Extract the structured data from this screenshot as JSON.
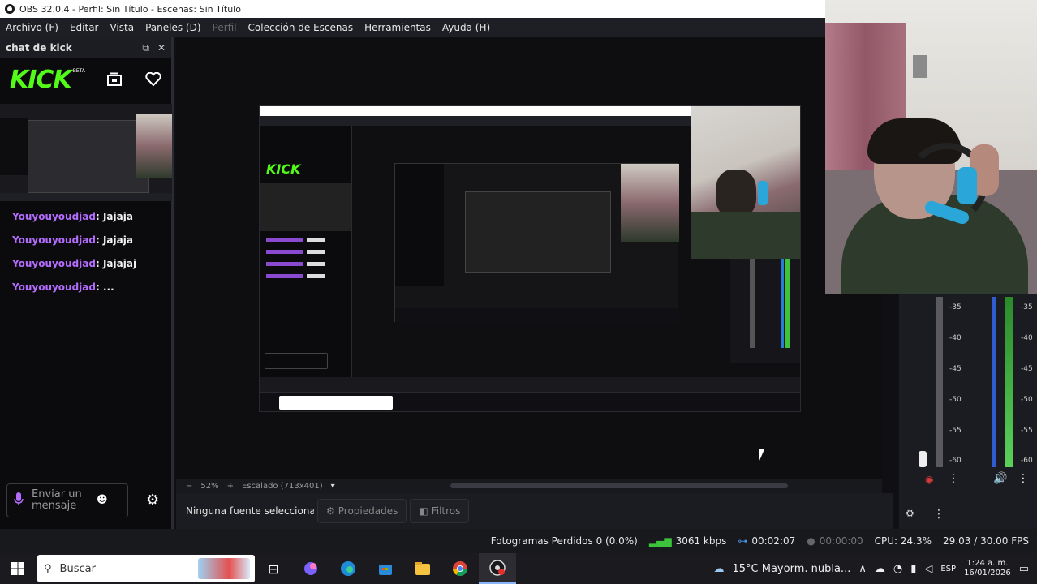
{
  "window": {
    "title": "OBS 32.0.4 - Perfil: Sin Título - Escenas: Sin Título"
  },
  "menu": [
    "Archivo (F)",
    "Editar",
    "Vista",
    "Paneles (D)",
    "Perfil",
    "Colección de Escenas",
    "Herramientas",
    "Ayuda (H)"
  ],
  "dock": {
    "title": "chat de kick",
    "logo": "KICK",
    "beta": "BETA",
    "send_placeholder": "Enviar un mensaje"
  },
  "chat": [
    {
      "user": "Youyouyoudjad",
      "text": ": Jajaja"
    },
    {
      "user": "Youyouyoudjad",
      "text": ": Jajaja"
    },
    {
      "user": "Youyouyoudjad",
      "text": ": Jajajaj"
    },
    {
      "user": "Youyouyoudjad",
      "text": ": ..."
    }
  ],
  "preview": {
    "zoom": "52%",
    "scaling": "Escalado (713x401)"
  },
  "toolbar": {
    "no_source": "Ninguna fuente seleccionad",
    "properties": "Propiedades",
    "filters": "Filtros"
  },
  "mixer": {
    "ticks": [
      "-35",
      "-40",
      "-45",
      "-50",
      "-55",
      "-60"
    ]
  },
  "status": {
    "dropped_frames": "Fotogramas Perdidos 0 (0.0%)",
    "bitrate": "3061 kbps",
    "stream_time": "00:02:07",
    "record_time": "00:00:00",
    "cpu": "CPU: 24.3%",
    "fps": "29.03 / 30.00 FPS"
  },
  "taskbar": {
    "search": "Buscar",
    "weather": "15°C  Mayorm. nubla...",
    "language": "ESP",
    "time": "1:24 a. m.",
    "date": "16/01/2026"
  },
  "colors": {
    "kick_green": "#53fc18",
    "username_purple": "#b46cff",
    "obs_bg": "#1b1c21"
  }
}
